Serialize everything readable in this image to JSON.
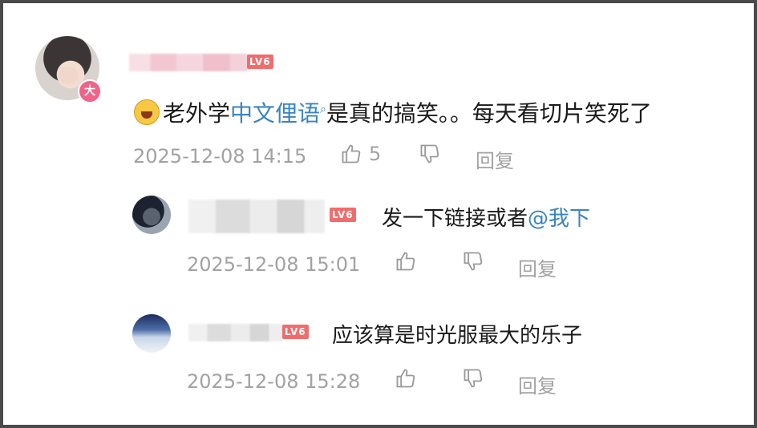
{
  "main_comment": {
    "level": "LV6",
    "badge": "大",
    "emoji": "laughing-emoji",
    "text_before": "老外学",
    "text_link": "中文俚语",
    "text_after": "是真的搞笑。。每天看切片笑死了",
    "timestamp": "2025-12-08 14:15",
    "likes": "5",
    "reply_label": "回复"
  },
  "replies": [
    {
      "level": "LV6",
      "text_before": "发一下链接或者",
      "mention": "@我下",
      "timestamp": "2025-12-08 15:01",
      "reply_label": "回复"
    },
    {
      "level": "LV6",
      "text": "应该算是时光服最大的乐子",
      "timestamp": "2025-12-08 15:28",
      "reply_label": "回复"
    }
  ],
  "colors": {
    "link": "#3a84c0",
    "level_badge": "#f06d6d",
    "meta_text": "#a2a2a2"
  }
}
